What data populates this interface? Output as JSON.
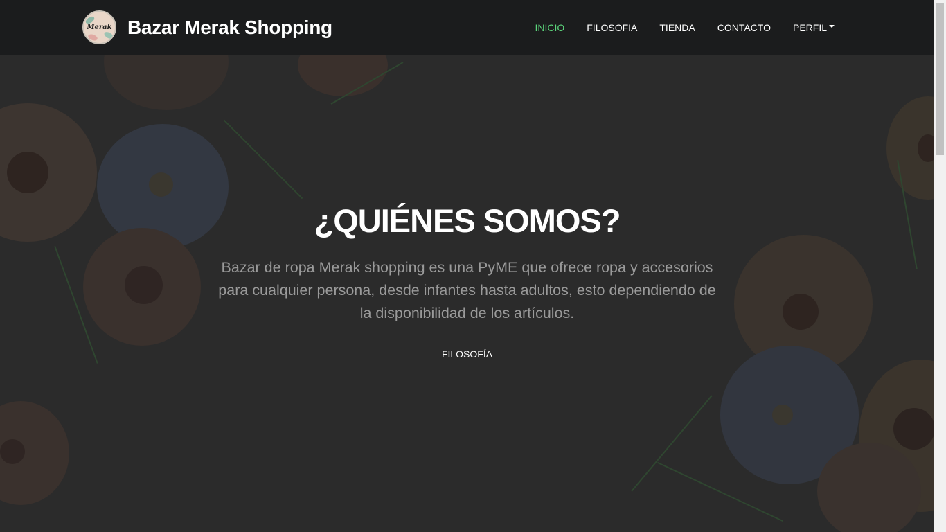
{
  "brand": {
    "logo_text": "Merak",
    "name": "Bazar Merak Shopping"
  },
  "nav": {
    "items": [
      {
        "label": "INICIO",
        "active": true
      },
      {
        "label": "FILOSOFIA",
        "active": false
      },
      {
        "label": "TIENDA",
        "active": false
      },
      {
        "label": "CONTACTO",
        "active": false
      },
      {
        "label": "PERFIL",
        "active": false,
        "dropdown": true
      }
    ]
  },
  "hero": {
    "title": "¿QUIÉNES SOMOS?",
    "text": "Bazar de ropa Merak shopping es una PyME que ofrece ropa y accesorios para cualquier persona, desde infantes hasta adultos, esto dependiendo de la disponibilidad de los artículos.",
    "link_label": "FILOSOFÍA"
  },
  "colors": {
    "navbar_bg": "#1b1c1d",
    "active_link": "#5cd67c",
    "hero_overlay": "#2b2b2b"
  }
}
